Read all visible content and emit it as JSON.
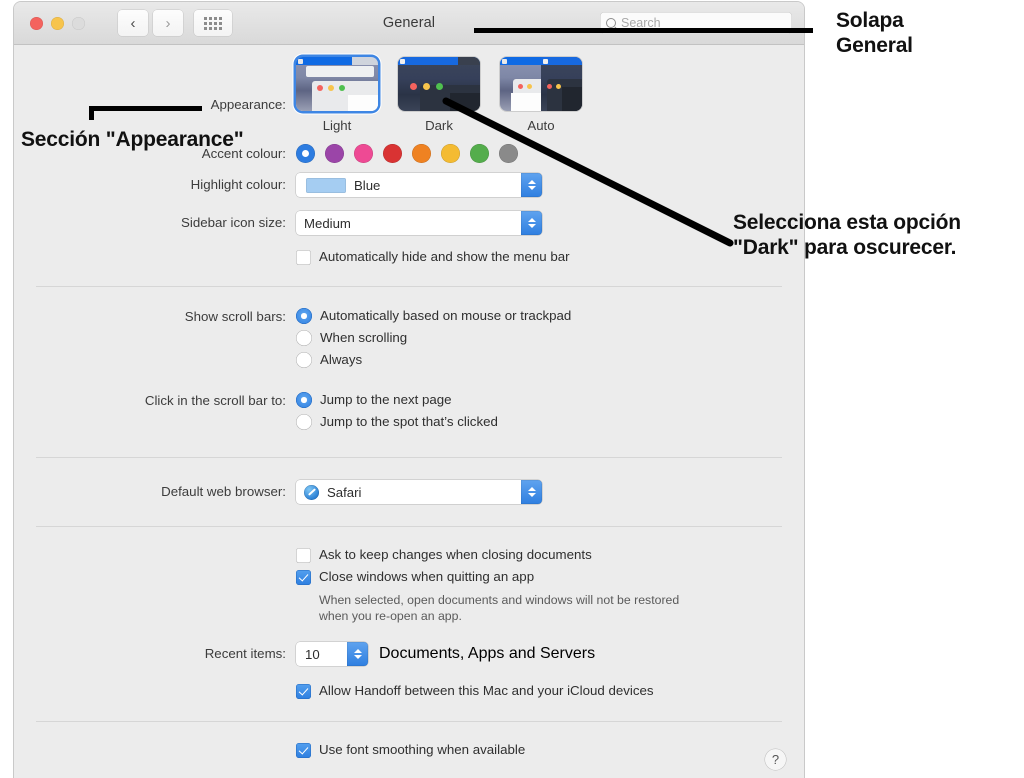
{
  "window": {
    "title": "General",
    "traffic_lights": [
      "close",
      "minimize",
      "zoom-disabled"
    ],
    "nav_back": "‹",
    "nav_forward": "›",
    "grid_button": "show-all",
    "search": {
      "placeholder": "Search",
      "value": ""
    }
  },
  "appearance": {
    "label": "Appearance:",
    "options": [
      {
        "name": "Light",
        "selected": true
      },
      {
        "name": "Dark",
        "selected": false
      },
      {
        "name": "Auto",
        "selected": false
      }
    ]
  },
  "accent": {
    "label": "Accent colour:",
    "swatches": [
      {
        "name": "blue",
        "hex": "#2d7ce0",
        "selected": true
      },
      {
        "name": "purple",
        "hex": "#9b45a8",
        "selected": false
      },
      {
        "name": "pink",
        "hex": "#ee4a94",
        "selected": false
      },
      {
        "name": "red",
        "hex": "#d93333",
        "selected": false
      },
      {
        "name": "orange",
        "hex": "#ef8222",
        "selected": false
      },
      {
        "name": "yellow",
        "hex": "#f4bb32",
        "selected": false
      },
      {
        "name": "green",
        "hex": "#54ad4c",
        "selected": false
      },
      {
        "name": "graphite",
        "hex": "#8a8a8a",
        "selected": false
      }
    ]
  },
  "highlight": {
    "label": "Highlight colour:",
    "value": "Blue",
    "swatch_hex": "#a5cdf2"
  },
  "sidebar_icon": {
    "label": "Sidebar icon size:",
    "value": "Medium"
  },
  "menubar_autohide": {
    "label": "Automatically hide and show the menu bar",
    "checked": false
  },
  "scrollbars": {
    "label": "Show scroll bars:",
    "options": [
      {
        "label": "Automatically based on mouse or trackpad",
        "selected": true
      },
      {
        "label": "When scrolling",
        "selected": false
      },
      {
        "label": "Always",
        "selected": false
      }
    ]
  },
  "scrollbar_click": {
    "label": "Click in the scroll bar to:",
    "options": [
      {
        "label": "Jump to the next page",
        "selected": true
      },
      {
        "label": "Jump to the spot that’s clicked",
        "selected": false
      }
    ]
  },
  "browser": {
    "label": "Default web browser:",
    "value": "Safari",
    "icon": "safari-icon"
  },
  "documents": {
    "ask_keep_changes": {
      "label": "Ask to keep changes when closing documents",
      "checked": false
    },
    "close_windows": {
      "label": "Close windows when quitting an app",
      "checked": true
    },
    "hint_line1": "When selected, open documents and windows will not be restored",
    "hint_line2": "when you re-open an app."
  },
  "recent_items": {
    "label": "Recent items:",
    "value": "10",
    "suffix": "Documents, Apps and Servers"
  },
  "handoff": {
    "label": "Allow Handoff between this Mac and your iCloud devices",
    "checked": true
  },
  "font_smoothing": {
    "label": "Use font smoothing when available",
    "checked": true
  },
  "help_button": "?",
  "annotations": {
    "tab_general_line1": "Solapa",
    "tab_general_line2": "General",
    "appearance_section": "Sección \"Appearance\"",
    "dark_option_line1": "Selecciona esta opción",
    "dark_option_line2": "\"Dark\" para oscurecer."
  }
}
